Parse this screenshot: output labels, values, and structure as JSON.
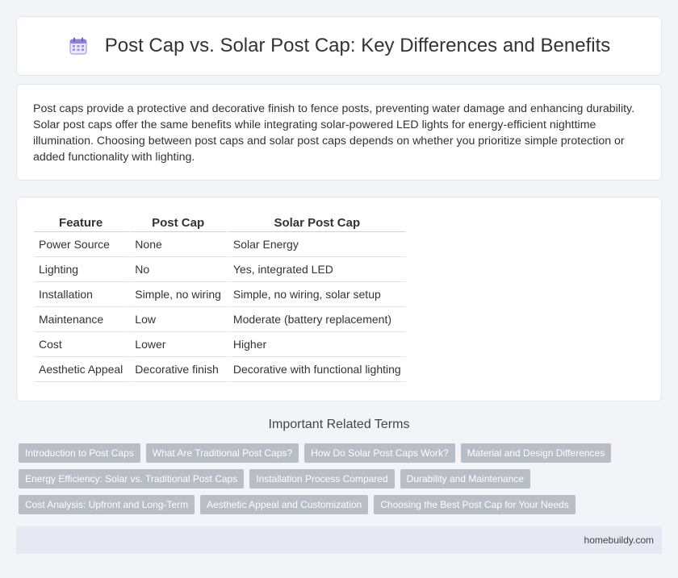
{
  "header": {
    "title": "Post Cap vs. Solar Post Cap: Key Differences and Benefits",
    "icon": "calendar-icon"
  },
  "intro": {
    "text": "Post caps provide a protective and decorative finish to fence posts, preventing water damage and enhancing durability. Solar post caps offer the same benefits while integrating solar-powered LED lights for energy-efficient nighttime illumination. Choosing between post caps and solar post caps depends on whether you prioritize simple protection or added functionality with lighting."
  },
  "table": {
    "headers": [
      "Feature",
      "Post Cap",
      "Solar Post Cap"
    ],
    "rows": [
      [
        "Power Source",
        "None",
        "Solar Energy"
      ],
      [
        "Lighting",
        "No",
        "Yes, integrated LED"
      ],
      [
        "Installation",
        "Simple, no wiring",
        "Simple, no wiring, solar setup"
      ],
      [
        "Maintenance",
        "Low",
        "Moderate (battery replacement)"
      ],
      [
        "Cost",
        "Lower",
        "Higher"
      ],
      [
        "Aesthetic Appeal",
        "Decorative finish",
        "Decorative with functional lighting"
      ]
    ]
  },
  "related": {
    "title": "Important Related Terms",
    "rows": [
      [
        "Introduction to Post Caps",
        "What Are Traditional Post Caps?",
        "How Do Solar Post Caps Work?",
        "Material and Design Differences"
      ],
      [
        "Energy Efficiency: Solar vs. Traditional Post Caps",
        "Installation Process Compared",
        "Durability and Maintenance"
      ],
      [
        "Cost Analysis: Upfront and Long-Term",
        "Aesthetic Appeal and Customization",
        "Choosing the Best Post Cap for Your Needs"
      ]
    ]
  },
  "footer": {
    "site": "homebuildy.com"
  }
}
